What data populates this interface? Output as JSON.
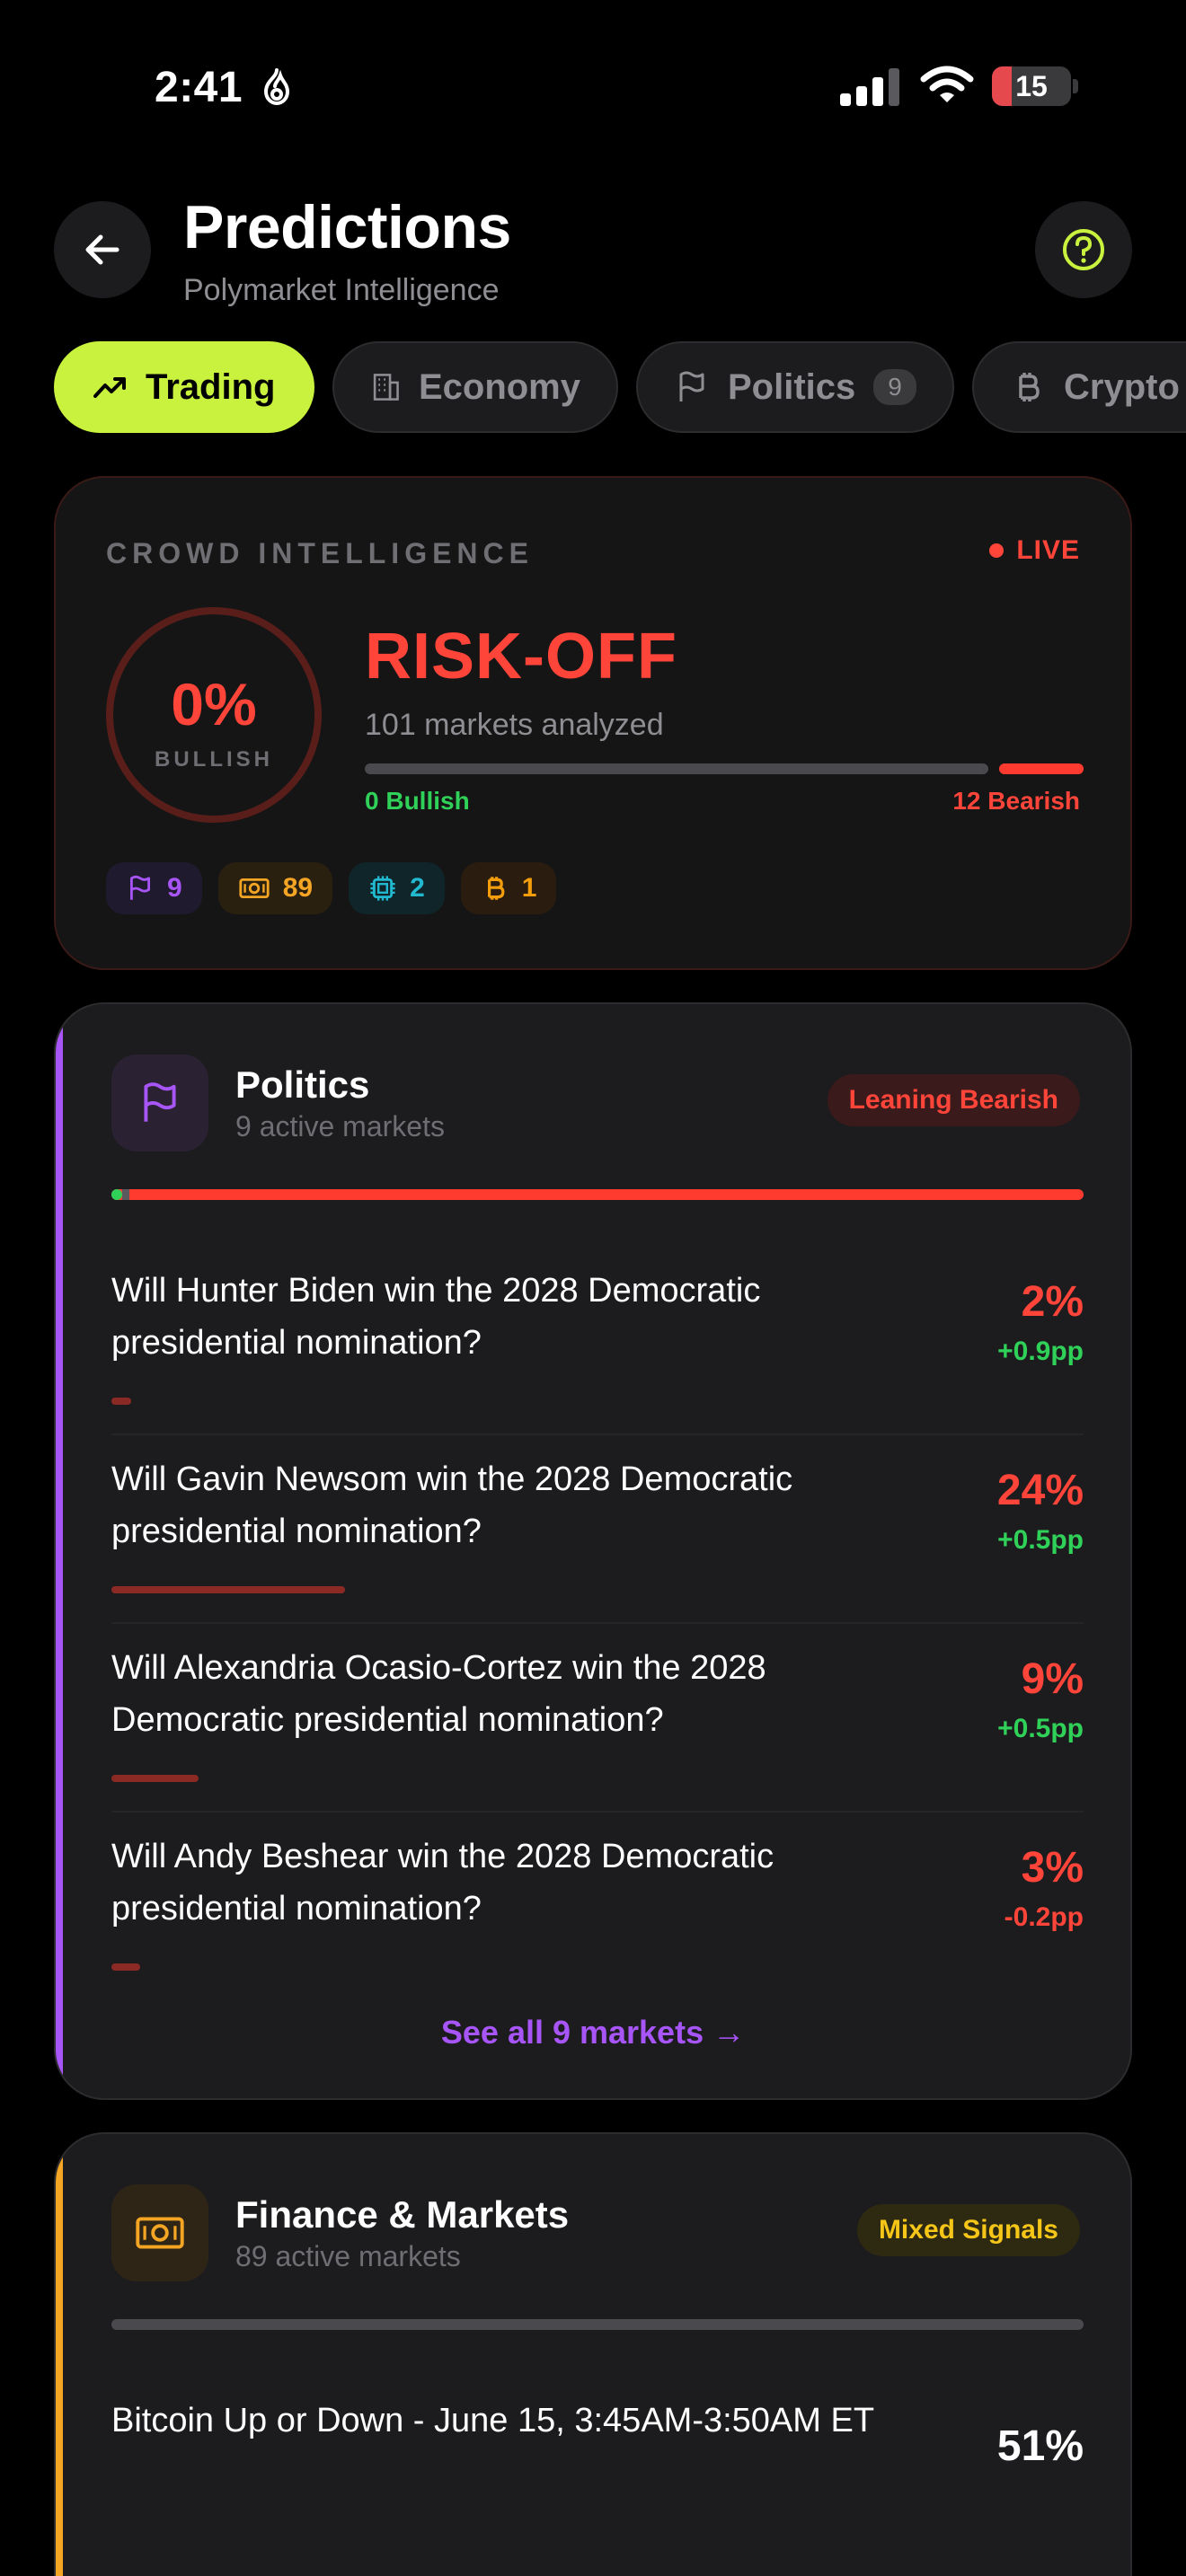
{
  "status_bar": {
    "time": "2:41",
    "battery": "15"
  },
  "header": {
    "title": "Predictions",
    "subtitle": "Polymarket Intelligence"
  },
  "tabs": [
    {
      "label": "Trading",
      "icon": "trending-up-icon",
      "active": true
    },
    {
      "label": "Economy",
      "icon": "building-icon"
    },
    {
      "label": "Politics",
      "icon": "flag-icon",
      "count": "9"
    },
    {
      "label": "Crypto",
      "icon": "bitcoin-icon"
    }
  ],
  "crowd": {
    "label": "CROWD INTELLIGENCE",
    "live": "LIVE",
    "bullish_pct": "0%",
    "bullish_label": "BULLISH",
    "bullish_fraction": 0,
    "verdict": "RISK-OFF",
    "analyzed": "101 markets analyzed",
    "bullish_count": "0 Bullish",
    "bearish_count": "12 Bearish",
    "chips": [
      {
        "icon": "flag-icon",
        "value": "9"
      },
      {
        "icon": "money-icon",
        "value": "89"
      },
      {
        "icon": "chip-icon",
        "value": "2"
      },
      {
        "icon": "bitcoin-icon",
        "value": "1"
      }
    ]
  },
  "politics": {
    "title": "Politics",
    "subtitle": "9 active markets",
    "badge": "Leaning Bearish",
    "accent": "#a855f7",
    "markets": [
      {
        "question": "Will Hunter Biden win the 2028 Democratic presidential nomination?",
        "pct": "2%",
        "change": "+0.9pp",
        "value": 2
      },
      {
        "question": "Will Gavin Newsom win the 2028 Democratic presidential nomination?",
        "pct": "24%",
        "change": "+0.5pp",
        "value": 24
      },
      {
        "question": "Will Alexandria Ocasio-Cortez win the 2028 Democratic presidential nomination?",
        "pct": "9%",
        "change": "+0.5pp",
        "value": 9
      },
      {
        "question": "Will Andy Beshear win the 2028 Democratic presidential nomination?",
        "pct": "3%",
        "change": "-0.2pp",
        "value": 3
      }
    ],
    "see_all": "See all 9 markets →"
  },
  "finance": {
    "title": "Finance & Markets",
    "subtitle": "89 active markets",
    "badge": "Mixed Signals",
    "accent": "#f5a524",
    "markets": [
      {
        "question": "Bitcoin Up or Down - June 15, 3:45AM-3:50AM ET",
        "pct": "51%"
      }
    ]
  }
}
